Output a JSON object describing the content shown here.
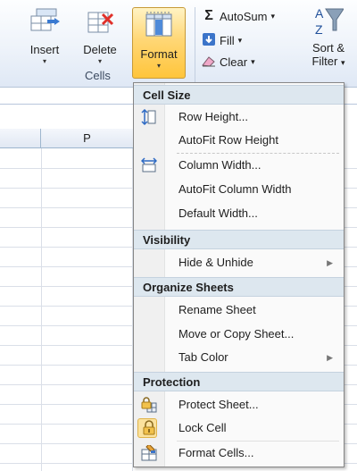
{
  "ribbon": {
    "insert_label": "Insert",
    "delete_label": "Delete",
    "format_label": "Format",
    "cells_group_label": "Cells",
    "autosum_label": "AutoSum",
    "fill_label": "Fill",
    "clear_label": "Clear",
    "sort_filter_line1": "Sort &",
    "sort_filter_line2": "Filter",
    "dropdown_caret": "▾"
  },
  "sheet": {
    "visible_column": "P"
  },
  "menu": {
    "sections": [
      {
        "title": "Cell Size",
        "items": [
          {
            "label": "Row Height...",
            "icon": "row-height-icon"
          },
          {
            "label": "AutoFit Row Height",
            "icon": ""
          },
          {
            "label": "Column Width...",
            "icon": "column-width-icon"
          },
          {
            "label": "AutoFit Column Width",
            "icon": ""
          },
          {
            "label": "Default Width...",
            "icon": ""
          }
        ]
      },
      {
        "title": "Visibility",
        "items": [
          {
            "label": "Hide & Unhide",
            "icon": "",
            "submenu": true
          }
        ]
      },
      {
        "title": "Organize Sheets",
        "items": [
          {
            "label": "Rename Sheet",
            "icon": ""
          },
          {
            "label": "Move or Copy Sheet...",
            "icon": ""
          },
          {
            "label": "Tab Color",
            "icon": "",
            "submenu": true
          }
        ]
      },
      {
        "title": "Protection",
        "items": [
          {
            "label": "Protect Sheet...",
            "icon": "protect-sheet-icon"
          },
          {
            "label": "Lock Cell",
            "icon": "lock-cell-icon"
          },
          {
            "label": "Format Cells...",
            "icon": "format-cells-icon"
          }
        ]
      }
    ],
    "submenu_arrow": "▶"
  },
  "colors": {
    "format_button_highlight": "#ffd776",
    "section_header_bg": "#dde7ef",
    "menu_bg": "#fafafa",
    "ribbon_bg": "#eef3fa"
  }
}
